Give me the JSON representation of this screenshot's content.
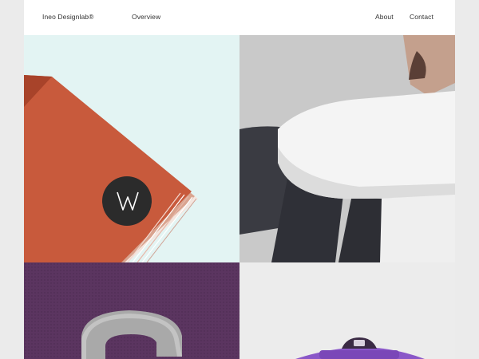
{
  "nav": {
    "brand": "Ineo Designlab®",
    "overview": "Overview",
    "about": "About",
    "contact": "Contact"
  },
  "logo_badge_letter": "W",
  "colors": {
    "page_background": "#ebebeb",
    "tile1_background": "#e3f4f3",
    "paper_orange": "#c85a3c",
    "badge_dark": "#2b2b2b",
    "tile3_purple": "#5b3560",
    "tile4_background": "#ececec",
    "skateboard_purple": "#8a57c8"
  },
  "tiles": [
    {
      "subject": "orange-stationery-with-w-logo"
    },
    {
      "subject": "person-in-white-shirt"
    },
    {
      "subject": "concrete-letter-on-purple"
    },
    {
      "subject": "purple-skateboard-truck"
    }
  ]
}
